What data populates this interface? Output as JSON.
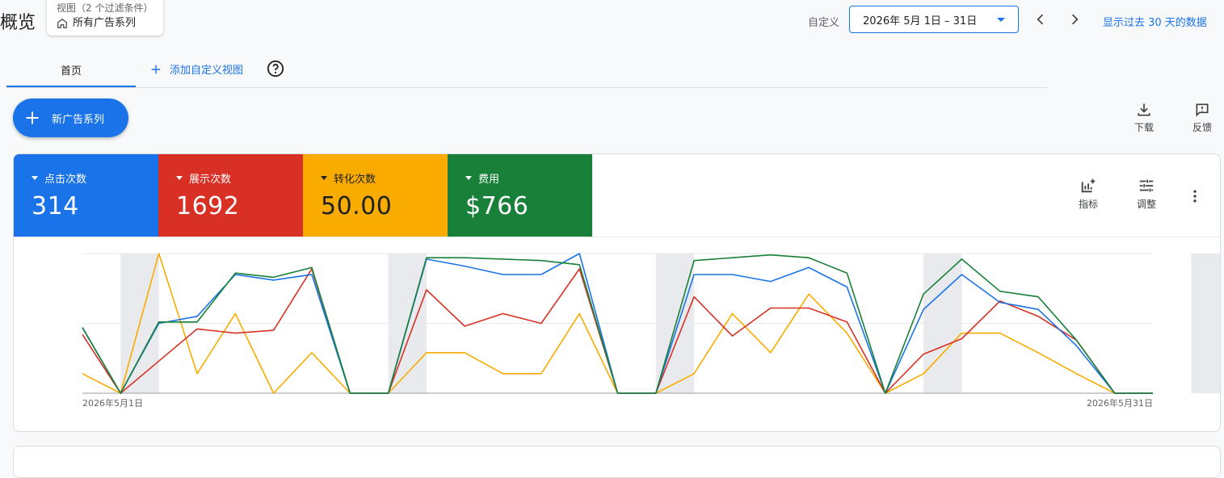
{
  "header": {
    "title": "概览",
    "view_chip": {
      "caption": "视图（2 个过滤条件）",
      "label": "所有广告系列"
    },
    "date_label": "自定义",
    "date_value": "2026年 5月 1日 – 31日",
    "last30_link": "显示过去 30 天的数据"
  },
  "tabs": {
    "home": "首页",
    "add_view": "添加自定义视图"
  },
  "new_campaign_button": "新广告系列",
  "tools": {
    "download": "下载",
    "feedback": "反馈"
  },
  "metrics": [
    {
      "label": "点击次数",
      "value": "314",
      "color": "#1a73e8"
    },
    {
      "label": "展示次数",
      "value": "1692",
      "color": "#d93025"
    },
    {
      "label": "转化次数",
      "value": "50.00",
      "color": "#f9ab00"
    },
    {
      "label": "费用",
      "value": "$766",
      "color": "#188038"
    }
  ],
  "card_tools": {
    "metrics": "指标",
    "adjust": "调整"
  },
  "chart_data": {
    "type": "line",
    "x": [
      "2026-05-01",
      "2026-05-02",
      "2026-05-03",
      "2026-05-04",
      "2026-05-05",
      "2026-05-06",
      "2026-05-07",
      "2026-05-08",
      "2026-05-09",
      "2026-05-10",
      "2026-05-11",
      "2026-05-12",
      "2026-05-13",
      "2026-05-14",
      "2026-05-15",
      "2026-05-16",
      "2026-05-17",
      "2026-05-18",
      "2026-05-19",
      "2026-05-20",
      "2026-05-21",
      "2026-05-22",
      "2026-05-23",
      "2026-05-24",
      "2026-05-25",
      "2026-05-26",
      "2026-05-27",
      "2026-05-28",
      "2026-05-29",
      "2026-05-30",
      "2026-05-31"
    ],
    "x_tick_labels": [
      "2026年5月1日",
      "2026年5月31日"
    ],
    "weekend_shading": [
      [
        1,
        2
      ],
      [
        8,
        9
      ],
      [
        15,
        16
      ],
      [
        22,
        23
      ],
      [
        29,
        30
      ]
    ],
    "ylim": [
      0,
      1
    ],
    "grid": true,
    "series": [
      {
        "color": "#f9ab00",
        "values": [
          0.14,
          0,
          1.0,
          0.14,
          0.57,
          0,
          0.29,
          0,
          0,
          0.29,
          0.29,
          0.14,
          0.14,
          0.57,
          0,
          0,
          0.14,
          0.57,
          0.29,
          0.71,
          0.43,
          0,
          0.14,
          0.43,
          0.43,
          0.29,
          0.14,
          0,
          0
        ]
      },
      {
        "color": "#d93025",
        "values": [
          0.42,
          0,
          0.23,
          0.46,
          0.43,
          0.45,
          0.89,
          0,
          0,
          0.74,
          0.48,
          0.57,
          0.5,
          0.89,
          0,
          0,
          0.69,
          0.41,
          0.61,
          0.61,
          0.51,
          0,
          0.28,
          0.39,
          0.66,
          0.55,
          0.38,
          0,
          0
        ]
      },
      {
        "color": "#1a73e8",
        "values": [
          0.47,
          0,
          0.5,
          0.55,
          0.85,
          0.81,
          0.85,
          0,
          0,
          0.96,
          0.91,
          0.85,
          0.85,
          1.0,
          0,
          0,
          0.85,
          0.85,
          0.8,
          0.9,
          0.76,
          0,
          0.6,
          0.85,
          0.65,
          0.6,
          0.34,
          0,
          0
        ]
      },
      {
        "color": "#188038",
        "values": [
          0.47,
          0,
          0.51,
          0.51,
          0.86,
          0.83,
          0.9,
          0,
          0,
          0.97,
          0.97,
          0.96,
          0.95,
          0.92,
          0,
          0,
          0.95,
          0.97,
          0.99,
          0.97,
          0.86,
          0,
          0.71,
          0.96,
          0.73,
          0.69,
          0.38,
          0,
          0
        ]
      }
    ]
  }
}
